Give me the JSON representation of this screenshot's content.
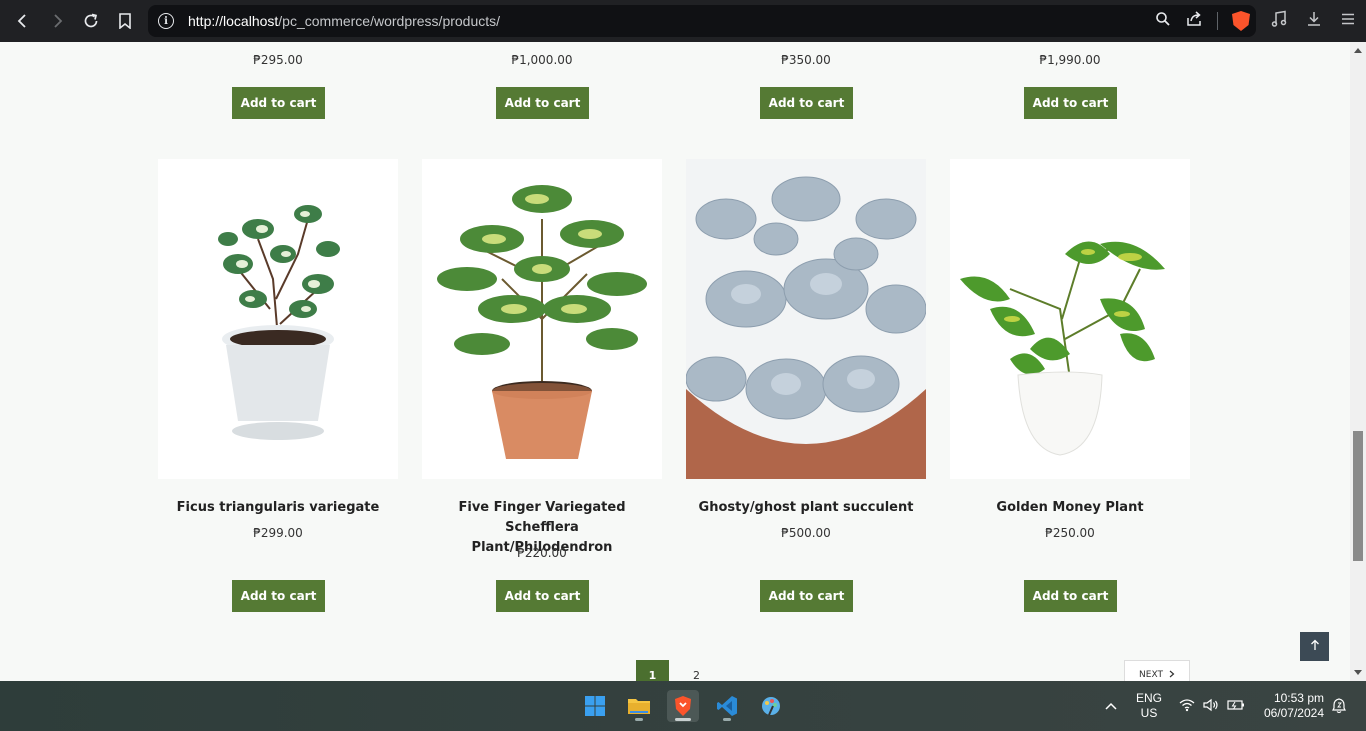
{
  "browser": {
    "url_host": "http://localhost",
    "url_path": "/pc_commerce/wordpress/products/"
  },
  "top_row": [
    {
      "price": "₱295.00",
      "button": "Add to cart"
    },
    {
      "price": "₱1,000.00",
      "button": "Add to cart"
    },
    {
      "price": "₱350.00",
      "button": "Add to cart"
    },
    {
      "price": "₱1,990.00",
      "button": "Add to cart"
    }
  ],
  "products": [
    {
      "title": "Ficus triangularis variegate",
      "price": "₱299.00",
      "button": "Add to cart"
    },
    {
      "title": "Five Finger Variegated Schefflera Plant/Philodendron",
      "price": "₱220.00",
      "button": "Add to cart"
    },
    {
      "title": "Ghosty/ghost plant succulent",
      "price": "₱500.00",
      "button": "Add to cart"
    },
    {
      "title": "Golden Money Plant",
      "price": "₱250.00",
      "button": "Add to cart"
    }
  ],
  "pagination": {
    "page1": "1",
    "page2": "2",
    "next": "NEXT"
  },
  "taskbar": {
    "lang1": "ENG",
    "lang2": "US",
    "time": "10:53 pm",
    "date": "06/07/2024"
  }
}
